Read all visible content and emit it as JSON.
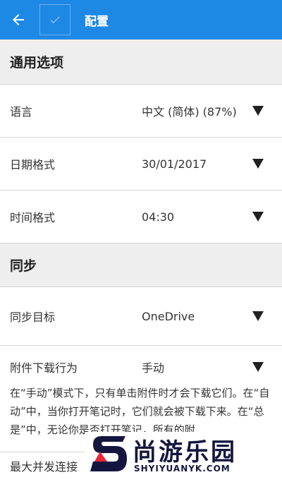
{
  "appbar": {
    "title": "配置",
    "color": "#1e88e5",
    "back_icon": "arrow-left-icon",
    "check_icon": "check-icon"
  },
  "sections": {
    "general": "通用选项",
    "sync": "同步"
  },
  "rows": {
    "language": {
      "label": "语言",
      "value": "中文 (简体) (87%)"
    },
    "date_format": {
      "label": "日期格式",
      "value": "30/01/2017"
    },
    "time_format": {
      "label": "时间格式",
      "value": "04:30"
    },
    "sync_target": {
      "label": "同步目标",
      "value": "OneDrive"
    },
    "attachment": {
      "label": "附件下载行为",
      "value": "手动",
      "description": "在“手动”模式下，只有单击附件时才会下载它们。在“自动”中，当你打开笔记时，它们就会被下载下来。在“总是”中，无论你是否打开笔记，所有的附"
    },
    "max_concurrent": {
      "label": "最大并发连接"
    }
  },
  "watermark": {
    "text": "尚游乐园",
    "url": "SHYIYUANYK.COM"
  }
}
